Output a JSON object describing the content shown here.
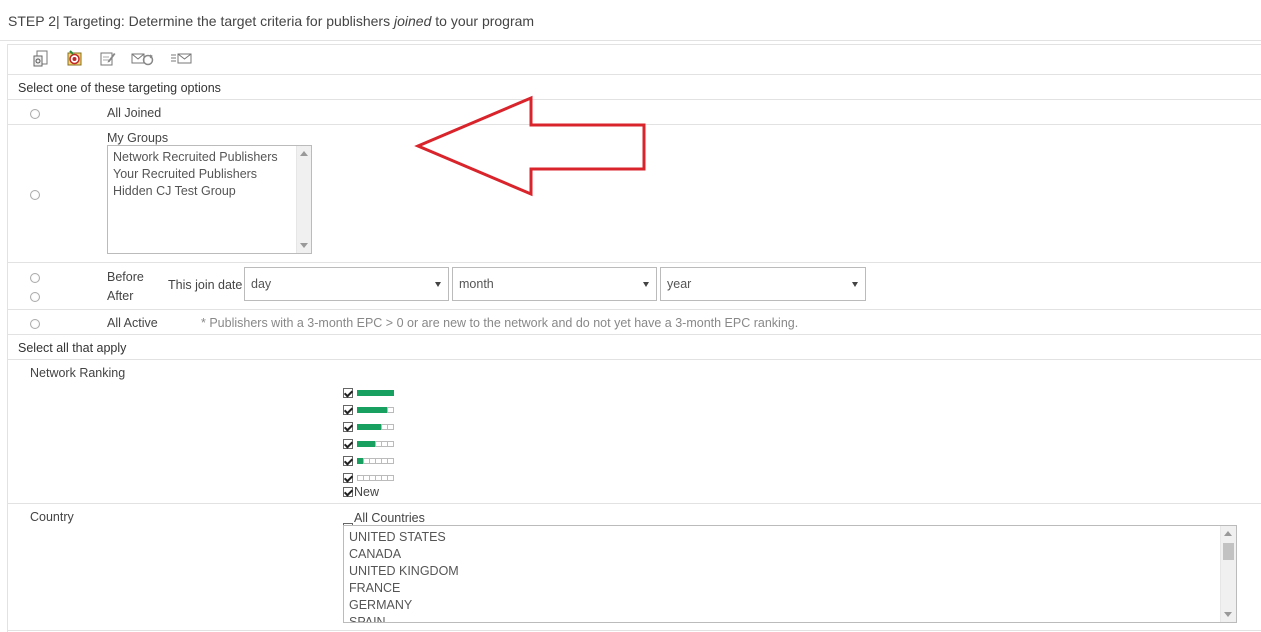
{
  "header": {
    "step": "STEP 2|",
    "title_pre": "Targeting: Determine the target criteria for publishers",
    "title_em": "joined",
    "title_post": "to your program"
  },
  "toolbar": {
    "icons": [
      "report-icon",
      "target-icon",
      "edit-icon",
      "mail-refresh-icon",
      "mail-list-icon"
    ]
  },
  "targeting": {
    "section_label": "Select one of these targeting options",
    "all_joined": "All Joined",
    "my_groups": "My Groups",
    "groups": [
      "Network Recruited Publishers",
      "Your Recruited Publishers",
      "Hidden CJ Test Group"
    ],
    "before": "Before",
    "after": "After",
    "join_date_label": "This join date",
    "day": "day",
    "month": "month",
    "year": "year",
    "all_active": "All Active",
    "all_active_note": "* Publishers with a 3-month EPC > 0 or are new to the network and do not yet have a 3-month EPC ranking."
  },
  "apply": {
    "section_label": "Select all that apply",
    "network_ranking_label": "Network Ranking",
    "rankings": [
      {
        "filled": 6,
        "checked": true
      },
      {
        "filled": 5,
        "checked": true
      },
      {
        "filled": 4,
        "checked": true
      },
      {
        "filled": 3,
        "checked": true
      },
      {
        "filled": 1,
        "checked": true
      },
      {
        "filled": 0,
        "checked": true
      }
    ],
    "new_label": "New",
    "country_label": "Country",
    "all_countries": "All Countries",
    "countries": [
      "UNITED STATES",
      "CANADA",
      "UNITED KINGDOM",
      "FRANCE",
      "GERMANY",
      "SPAIN"
    ]
  },
  "colors": {
    "rank_fill": "#18a060",
    "annotation_arrow": "#d9242c"
  }
}
